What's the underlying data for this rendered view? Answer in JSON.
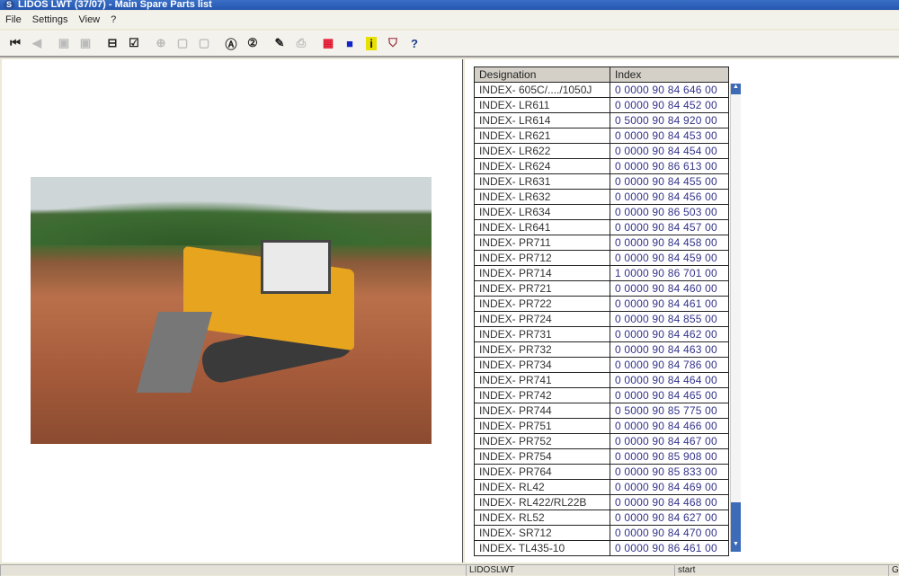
{
  "window": {
    "title": "LIDOS LWT  (37/07) - Main Spare Parts list"
  },
  "menu": [
    "File",
    "Settings",
    "View",
    "?"
  ],
  "toolbar": [
    {
      "icon": "first-record-icon",
      "glyph": "⏮",
      "enabled": true
    },
    {
      "icon": "previous-icon",
      "glyph": "◀",
      "enabled": false
    },
    {
      "icon": "page-back-icon",
      "glyph": "▣",
      "enabled": false
    },
    {
      "icon": "page-forward-icon",
      "glyph": "▣",
      "enabled": false
    },
    {
      "icon": "basket-icon",
      "glyph": "⊟",
      "enabled": true
    },
    {
      "icon": "edit-list-icon",
      "glyph": "☑",
      "enabled": true
    },
    {
      "icon": "zoom-icon",
      "glyph": "⊕",
      "enabled": false
    },
    {
      "icon": "fit-icon",
      "glyph": "▢",
      "enabled": false
    },
    {
      "icon": "fit-page-icon",
      "glyph": "▢",
      "enabled": false
    },
    {
      "icon": "search-a-icon",
      "glyph": "Ⓐ",
      "enabled": true
    },
    {
      "icon": "search-2-icon",
      "glyph": "②",
      "enabled": true
    },
    {
      "icon": "note-icon",
      "glyph": "✎",
      "enabled": true
    },
    {
      "icon": "print-icon",
      "glyph": "⎙",
      "enabled": false
    },
    {
      "icon": "grid-icon",
      "glyph": "▦",
      "enabled": true,
      "color": "#e0102a"
    },
    {
      "icon": "blue-square-icon",
      "glyph": "■",
      "enabled": true,
      "color": "#1024c8"
    },
    {
      "icon": "info-icon",
      "glyph": "i",
      "enabled": true,
      "color": "#e8e000"
    },
    {
      "icon": "shield-icon",
      "glyph": "⛉",
      "enabled": true,
      "color": "#9a2b3a"
    },
    {
      "icon": "help-icon",
      "glyph": "?",
      "enabled": true,
      "color": "#1a3a8a"
    }
  ],
  "table": {
    "headers": [
      "Designation",
      "Index"
    ],
    "rows": [
      [
        "INDEX- 605C/..../1050J",
        "0 0000  90 84 646 00"
      ],
      [
        "INDEX- LR611",
        "0 0000  90 84 452 00"
      ],
      [
        "INDEX- LR614",
        "0 5000  90 84 920 00"
      ],
      [
        "INDEX- LR621",
        "0 0000  90 84 453 00"
      ],
      [
        "INDEX- LR622",
        "0 0000  90 84 454 00"
      ],
      [
        "INDEX- LR624",
        "0 0000  90 86 613 00"
      ],
      [
        "INDEX- LR631",
        "0 0000  90 84 455 00"
      ],
      [
        "INDEX- LR632",
        "0 0000  90 84 456 00"
      ],
      [
        "INDEX- LR634",
        "0 0000  90 86 503 00"
      ],
      [
        "INDEX- LR641",
        "0 0000  90 84 457 00"
      ],
      [
        "INDEX- PR711",
        "0 0000  90 84 458 00"
      ],
      [
        "INDEX- PR712",
        "0 0000  90 84 459 00"
      ],
      [
        "INDEX- PR714",
        "1 0000  90 86 701 00"
      ],
      [
        "INDEX- PR721",
        "0 0000  90 84 460 00"
      ],
      [
        "INDEX- PR722",
        "0 0000  90 84 461 00"
      ],
      [
        "INDEX- PR724",
        "0 0000  90 84 855 00"
      ],
      [
        "INDEX- PR731",
        "0 0000  90 84 462 00"
      ],
      [
        "INDEX- PR732",
        "0 0000  90 84 463 00"
      ],
      [
        "INDEX- PR734",
        "0 0000  90 84 786 00"
      ],
      [
        "INDEX- PR741",
        "0 0000  90 84 464 00"
      ],
      [
        "INDEX- PR742",
        "0 0000  90 84 465 00"
      ],
      [
        "INDEX- PR744",
        "0 5000  90 85 775 00"
      ],
      [
        "INDEX- PR751",
        "0 0000  90 84 466 00"
      ],
      [
        "INDEX- PR752",
        "0 0000  90 84 467 00"
      ],
      [
        "INDEX- PR754",
        "0 0000  90 85 908 00"
      ],
      [
        "INDEX- PR764",
        "0 0000  90 85 833 00"
      ],
      [
        "INDEX- RL42",
        "0 0000  90 84 469 00"
      ],
      [
        "INDEX- RL422/RL22B",
        "0 0000  90 84 468 00"
      ],
      [
        "INDEX- RL52",
        "0 0000  90 84 627 00"
      ],
      [
        "INDEX- SR712",
        "0 0000  90 84 470 00"
      ],
      [
        "INDEX- TL435-10",
        "0 0000  90 86 461 00"
      ]
    ]
  },
  "status": {
    "app": "LIDOSLWT",
    "state": "start",
    "extra": "GR"
  }
}
